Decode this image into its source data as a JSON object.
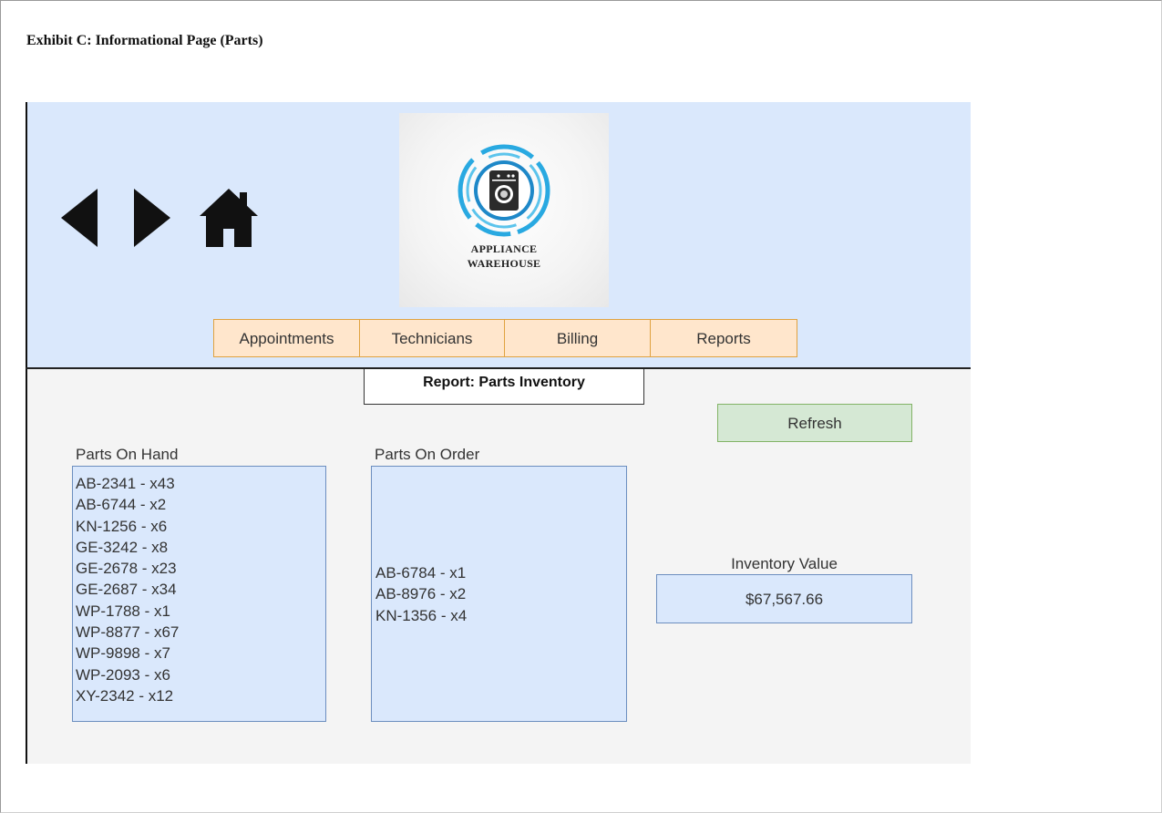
{
  "exhibit_title": "Exhibit C:  Informational Page (Parts)",
  "nav": {
    "back_icon": "triangle-left-icon",
    "forward_icon": "triangle-right-icon",
    "home_icon": "house-icon"
  },
  "logo": {
    "line1": "APPLIANCE",
    "line2": "WAREHOUSE",
    "icon": "washing-machine-icon",
    "ring_color": "#29a9e1"
  },
  "menu": [
    {
      "label": "Appointments"
    },
    {
      "label": "Technicians"
    },
    {
      "label": "Billing"
    },
    {
      "label": "Reports"
    }
  ],
  "report_title": "Report: Parts Inventory",
  "refresh_label": "Refresh",
  "parts_on_hand": {
    "label": "Parts On Hand",
    "items": [
      "AB-2341 - x43",
      "AB-6744 - x2",
      "KN-1256 - x6",
      "GE-3242 - x8",
      "GE-2678 - x23",
      "GE-2687 - x34",
      "WP-1788 - x1",
      "WP-8877 - x67",
      "WP-9898 - x7",
      "WP-2093 - x6",
      "XY-2342 - x12"
    ]
  },
  "parts_on_order": {
    "label": "Parts On Order",
    "items": [
      "AB-6784 - x1",
      "AB-8976 - x2",
      "KN-1356 - x4"
    ]
  },
  "inventory_value": {
    "label": "Inventory Value",
    "value": "$67,567.66"
  },
  "colors": {
    "header_bg": "#dae8fc",
    "menu_bg": "#ffe6cc",
    "menu_border": "#e0a240",
    "refresh_bg": "#d5e8d4",
    "refresh_border": "#82b366",
    "box_border": "#6c8ebf"
  }
}
